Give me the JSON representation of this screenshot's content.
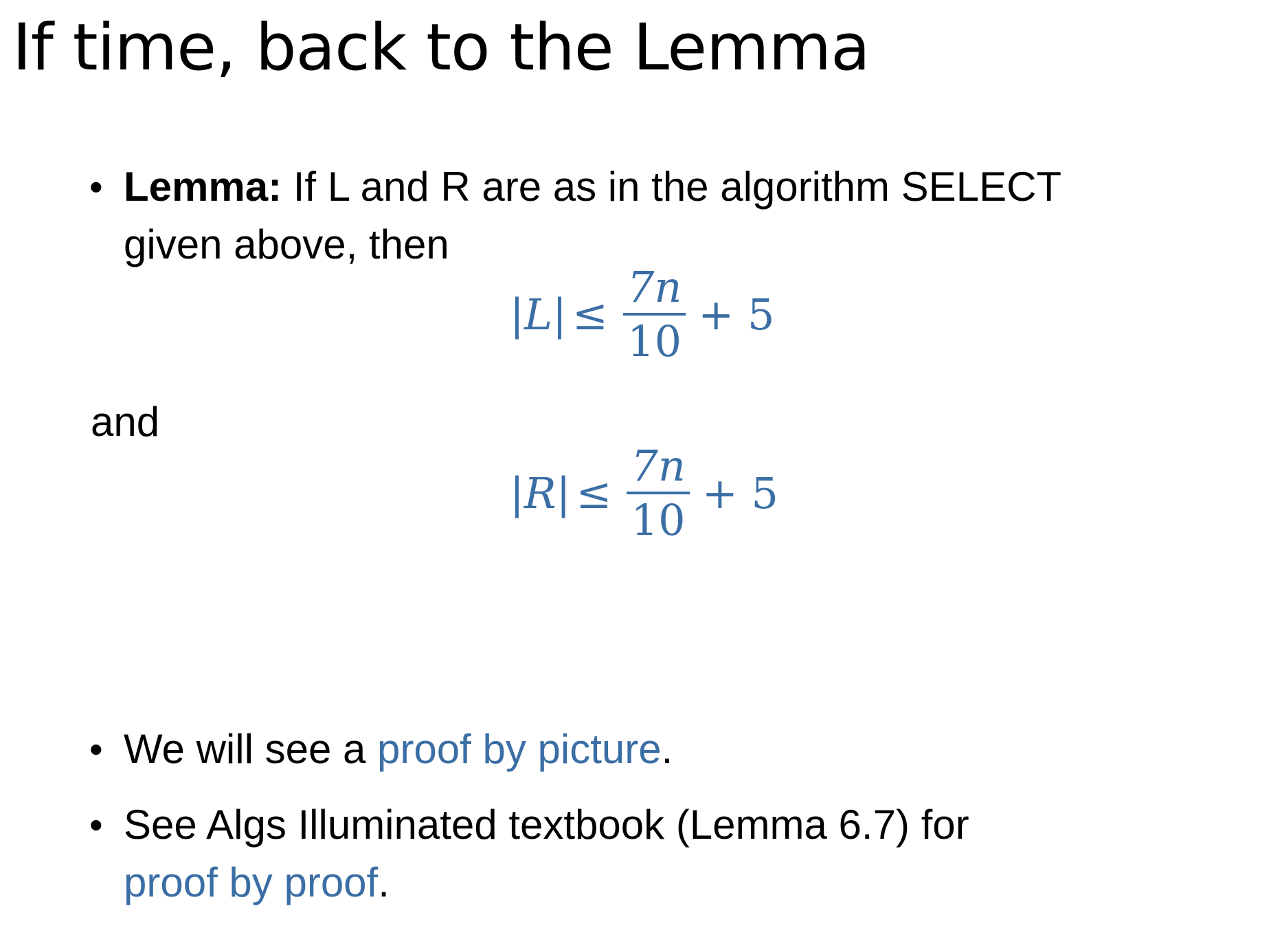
{
  "title": "If time, back to the Lemma",
  "lemma": {
    "label": "Lemma:",
    "line1": " If L and R are as in the algorithm SELECT",
    "line2": "given above, then"
  },
  "formula_L": {
    "lhs": "|L|",
    "rel": "≤",
    "numerator": "7n",
    "denominator": "10",
    "tail": "+ 5"
  },
  "and_text": "and",
  "formula_R": {
    "lhs": "|R|",
    "rel": "≤",
    "numerator": "7n",
    "denominator": "10",
    "tail": "+ 5"
  },
  "bullet_picture": {
    "before": "We will see a ",
    "link": "proof by picture",
    "after": "."
  },
  "bullet_textbook": {
    "line1": "See Algs Illuminated textbook (Lemma 6.7) for",
    "link": "proof by proof",
    "after": "."
  },
  "colors": {
    "accent": "#3a6ea5",
    "text": "#000000",
    "background": "#ffffff"
  }
}
